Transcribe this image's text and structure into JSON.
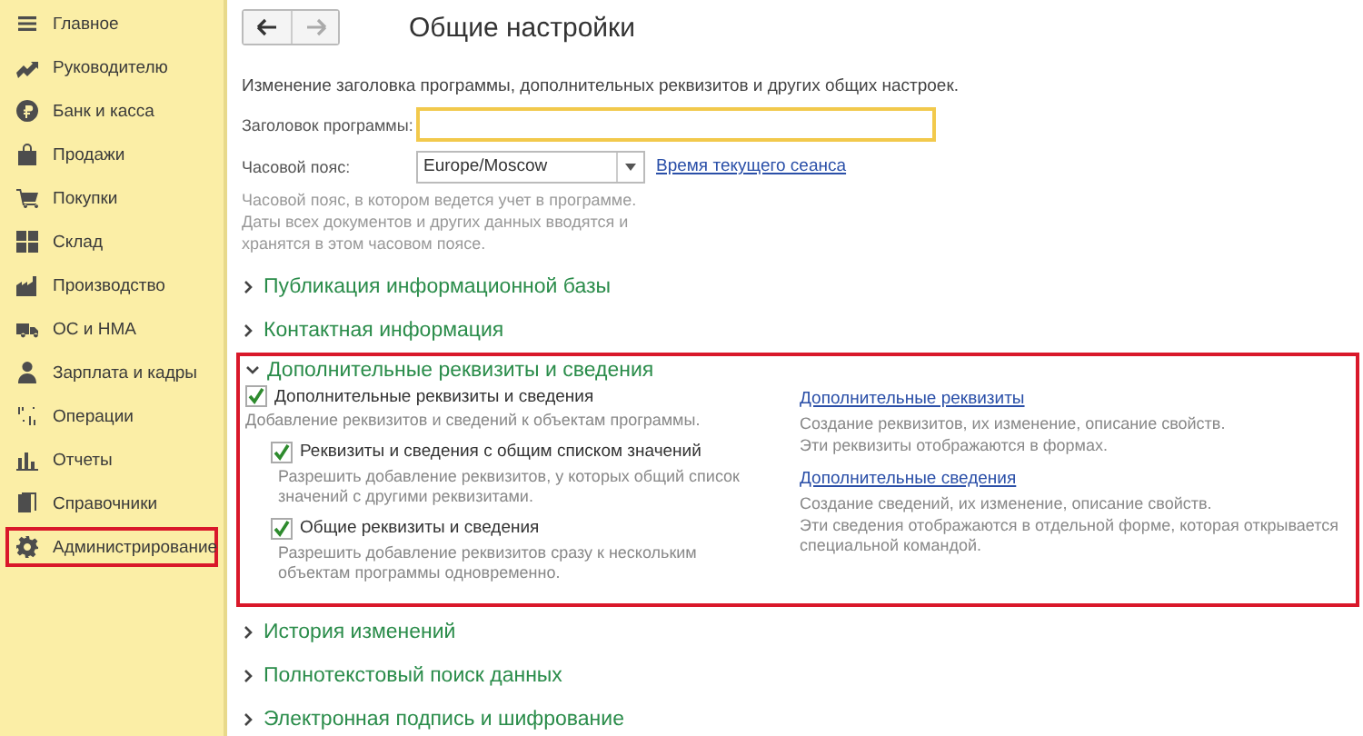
{
  "sidebar": {
    "items": [
      {
        "label": "Главное",
        "highlighted": false
      },
      {
        "label": "Руководителю",
        "highlighted": false
      },
      {
        "label": "Банк и касса",
        "highlighted": false
      },
      {
        "label": "Продажи",
        "highlighted": false
      },
      {
        "label": "Покупки",
        "highlighted": false
      },
      {
        "label": "Склад",
        "highlighted": false
      },
      {
        "label": "Производство",
        "highlighted": false
      },
      {
        "label": "ОС и НМА",
        "highlighted": false
      },
      {
        "label": "Зарплата и кадры",
        "highlighted": false
      },
      {
        "label": "Операции",
        "highlighted": false
      },
      {
        "label": "Отчеты",
        "highlighted": false
      },
      {
        "label": "Справочники",
        "highlighted": false
      },
      {
        "label": "Администрирование",
        "highlighted": true
      }
    ]
  },
  "nav": {
    "back_disabled": false,
    "forward_disabled": true
  },
  "title": "Общие настройки",
  "description": "Изменение заголовка программы, дополнительных реквизитов и других общих настроек.",
  "fields": [
    {
      "kind": "text",
      "label": "Заголовок программы:",
      "focused": true
    },
    {
      "kind": "select",
      "label": "Часовой пояс:",
      "value": "Europe/Moscow",
      "link": "Время текущего сеанса",
      "hint": "Часовой пояс, в котором ведется учет в программе. Даты всех документов и других данных вводятся и хранятся в этом часовом поясе."
    }
  ],
  "sections": [
    {
      "title": "Публикация информационной базы",
      "expanded": false,
      "highlighted": false
    },
    {
      "title": "Контактная информация",
      "expanded": false,
      "highlighted": false
    },
    {
      "title": "Дополнительные реквизиты и сведения",
      "expanded": true,
      "highlighted": true,
      "options": [
        {
          "label": "Дополнительные реквизиты и сведения",
          "checked": true,
          "description": "Добавление реквизитов и сведений к объектам программы.",
          "children": [
            {
              "label": "Реквизиты и сведения с общим списком значений",
              "checked": true,
              "description": "Разрешить добавление реквизитов, у которых общий список значений с другими реквизитами."
            },
            {
              "label": "Общие реквизиты и сведения",
              "checked": true,
              "description": "Разрешить добавление реквизитов сразу к нескольким объектам программы одновременно."
            }
          ]
        }
      ],
      "links": [
        {
          "label": "Дополнительные реквизиты",
          "description": "Создание реквизитов, их изменение, описание свойств.\nЭти реквизиты отображаются в формах."
        },
        {
          "label": "Дополнительные сведения",
          "description": "Создание сведений, их изменение, описание свойств.\nЭти сведения отображаются в отдельной форме, которая открывается специальной командой."
        }
      ]
    },
    {
      "title": "История изменений",
      "expanded": false,
      "highlighted": false
    },
    {
      "title": "Полнотекстовый поиск данных",
      "expanded": false,
      "highlighted": false
    },
    {
      "title": "Электронная подпись и шифрование",
      "expanded": false,
      "highlighted": false
    }
  ]
}
